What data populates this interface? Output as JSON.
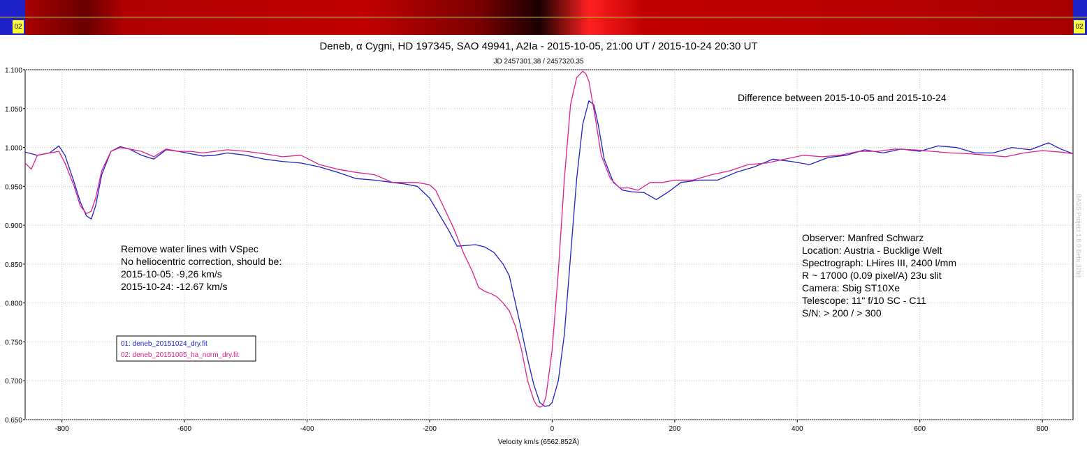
{
  "spectrum_strip": {
    "left_label": "02",
    "right_label": "02"
  },
  "chart_data": {
    "type": "line",
    "title": "Deneb, α Cygni, HD 197345, SAO 49941, A2Ia - 2015-10-05, 21:00 UT / 2015-10-24 20:30 UT",
    "subtitle": "JD 2457301.38 / 2457320.35",
    "xlabel": "Velocity km/s (6562.852Å)",
    "ylabel": "",
    "xlim": [
      -860,
      850
    ],
    "ylim": [
      0.65,
      1.1
    ],
    "xticks": [
      -800,
      -600,
      -400,
      -200,
      0,
      200,
      400,
      600,
      800
    ],
    "yticks": [
      "0.650",
      "0.700",
      "0.750",
      "0.800",
      "0.850",
      "0.900",
      "0.950",
      "1.000",
      "1.050",
      "1.100"
    ],
    "grid": true,
    "legend_position": "left, below middle",
    "series": [
      {
        "name": "01: deneb_20151024_dry.fit",
        "color": "#2020c8",
        "x": [
          -860,
          -840,
          -820,
          -805,
          -795,
          -780,
          -770,
          -760,
          -752,
          -745,
          -735,
          -720,
          -705,
          -690,
          -670,
          -650,
          -630,
          -610,
          -590,
          -570,
          -550,
          -530,
          -500,
          -470,
          -440,
          -410,
          -380,
          -350,
          -320,
          -290,
          -260,
          -240,
          -220,
          -200,
          -185,
          -170,
          -155,
          -140,
          -125,
          -110,
          -95,
          -80,
          -70,
          -60,
          -50,
          -40,
          -30,
          -20,
          -12,
          -5,
          0,
          10,
          20,
          30,
          40,
          50,
          60,
          68,
          75,
          85,
          100,
          115,
          130,
          150,
          170,
          190,
          210,
          240,
          270,
          300,
          330,
          360,
          390,
          420,
          450,
          480,
          510,
          540,
          570,
          600,
          630,
          660,
          690,
          720,
          750,
          780,
          810,
          830,
          850
        ],
        "y": [
          0.994,
          0.99,
          0.993,
          1.002,
          0.99,
          0.955,
          0.93,
          0.912,
          0.908,
          0.925,
          0.965,
          0.995,
          1.001,
          0.998,
          0.99,
          0.985,
          0.997,
          0.995,
          0.992,
          0.989,
          0.99,
          0.993,
          0.99,
          0.985,
          0.982,
          0.98,
          0.975,
          0.968,
          0.96,
          0.958,
          0.955,
          0.953,
          0.95,
          0.935,
          0.915,
          0.895,
          0.873,
          0.874,
          0.875,
          0.872,
          0.865,
          0.85,
          0.835,
          0.8,
          0.765,
          0.728,
          0.695,
          0.672,
          0.667,
          0.668,
          0.672,
          0.7,
          0.76,
          0.86,
          0.96,
          1.03,
          1.06,
          1.055,
          1.03,
          0.985,
          0.955,
          0.945,
          0.943,
          0.942,
          0.933,
          0.943,
          0.955,
          0.958,
          0.958,
          0.968,
          0.975,
          0.985,
          0.982,
          0.978,
          0.987,
          0.99,
          0.997,
          0.993,
          0.998,
          0.995,
          1.002,
          1.0,
          0.993,
          0.993,
          1.0,
          0.997,
          1.006,
          0.998,
          0.992
        ]
      },
      {
        "name": "02: deneb_20151005_ha_norm_dry.fit",
        "color": "#e0208c",
        "x": [
          -860,
          -850,
          -840,
          -820,
          -805,
          -795,
          -780,
          -770,
          -760,
          -752,
          -745,
          -735,
          -720,
          -705,
          -690,
          -670,
          -650,
          -630,
          -610,
          -590,
          -570,
          -550,
          -530,
          -500,
          -470,
          -440,
          -410,
          -380,
          -350,
          -320,
          -290,
          -260,
          -240,
          -220,
          -200,
          -190,
          -175,
          -160,
          -145,
          -130,
          -120,
          -110,
          -100,
          -90,
          -80,
          -70,
          -60,
          -50,
          -40,
          -30,
          -25,
          -20,
          -15,
          -10,
          0,
          10,
          20,
          30,
          40,
          50,
          55,
          60,
          70,
          80,
          95,
          110,
          125,
          140,
          160,
          180,
          200,
          230,
          260,
          290,
          320,
          350,
          380,
          410,
          440,
          470,
          500,
          530,
          560,
          590,
          620,
          650,
          680,
          710,
          740,
          770,
          800,
          830,
          850
        ],
        "y": [
          0.98,
          0.972,
          0.99,
          0.993,
          0.995,
          0.98,
          0.95,
          0.925,
          0.915,
          0.918,
          0.935,
          0.97,
          0.995,
          1.0,
          0.998,
          0.995,
          0.988,
          0.998,
          0.995,
          0.995,
          0.993,
          0.995,
          0.997,
          0.995,
          0.992,
          0.988,
          0.99,
          0.978,
          0.972,
          0.968,
          0.965,
          0.955,
          0.955,
          0.955,
          0.952,
          0.945,
          0.92,
          0.895,
          0.865,
          0.84,
          0.82,
          0.815,
          0.812,
          0.808,
          0.8,
          0.79,
          0.77,
          0.74,
          0.7,
          0.675,
          0.668,
          0.666,
          0.668,
          0.68,
          0.74,
          0.84,
          0.96,
          1.055,
          1.09,
          1.098,
          1.095,
          1.085,
          1.04,
          0.99,
          0.96,
          0.948,
          0.948,
          0.945,
          0.955,
          0.955,
          0.958,
          0.958,
          0.965,
          0.97,
          0.978,
          0.98,
          0.985,
          0.99,
          0.988,
          0.99,
          0.995,
          0.995,
          0.998,
          0.997,
          0.995,
          0.993,
          0.992,
          0.99,
          0.988,
          0.993,
          0.996,
          0.994,
          0.992
        ]
      }
    ],
    "annotations": {
      "difference": "Difference between 2015-10-05 and 2015-10-24",
      "notes": [
        "Remove water lines with VSpec",
        "No heliocentric correction, should be:",
        "2015-10-05: -9,26 km/s",
        "2015-10-24: -12.67 km/s"
      ],
      "observer": [
        "Observer: Manfred Schwarz",
        "Location: Austria - Bucklige Welt",
        "Spectrograph: LHires III, 2400 l/mm",
        "R ~ 17000 (0.09 pixel/A) 23u slit",
        "Camera: Sbig ST10Xe",
        "Telescope: 11\" f/10 SC - C11",
        "S/N: > 200 / > 300"
      ],
      "watermark": "BASS Project 1.8.0 Beta 32bit"
    }
  }
}
